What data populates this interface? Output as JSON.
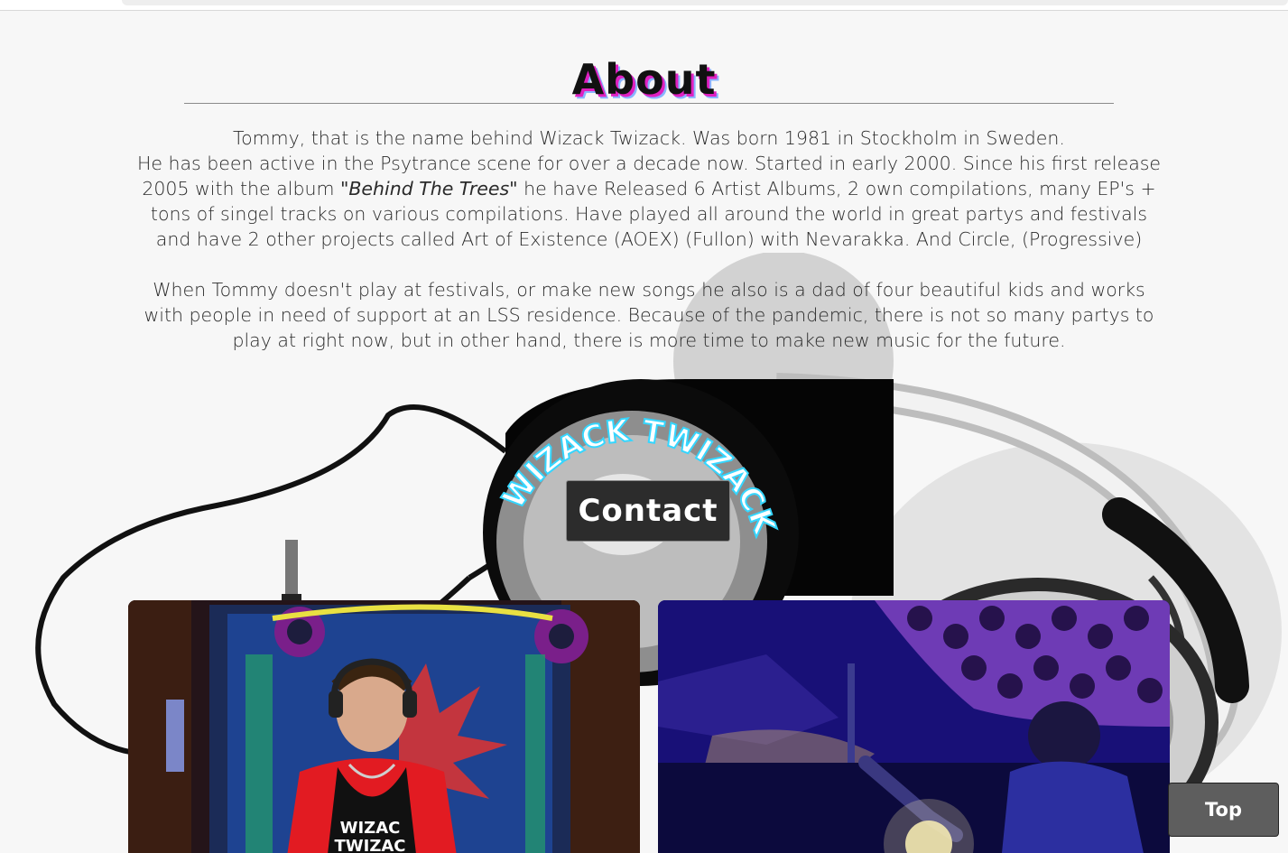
{
  "about": {
    "title": "About",
    "para1_line1": "Tommy, that is the name behind Wizack Twizack. Was born 1981 in Stockholm in Sweden.",
    "para1_line2": "He has been active in the Psytrance scene for over a decade now. Started in early 2000. Since his first release",
    "para1_line3_pre": "2005 with the album ",
    "para1_album": "\"Behind The Trees\"",
    "para1_line3_post": " he have Released 6 Artist Albums, 2 own compilations, many EP's +",
    "para1_line4": "tons of singel tracks on various compilations. Have played all around the world in great partys and festivals",
    "para1_line5": "and have 2 other projects called Art of Existence (AOEX) (Fullon) with Nevarakka. And Circle, (Progressive)",
    "para2_line1": "When Tommy doesn't play at festivals, or make new songs he also is a dad of four beautiful kids and works",
    "para2_line2": "with people in need of support at an LSS residence. Because of the pandemic, there is not so many partys to",
    "para2_line3": "play at right now, but in other hand, there is more time to make new music for the future."
  },
  "logo": {
    "text": "WIZACK TWIZACK"
  },
  "contact": {
    "label": "Contact"
  },
  "photos": {
    "left_shirt_text": "WIZAC\nTWIZAC"
  },
  "nav": {
    "top_label": "Top"
  },
  "colors": {
    "title_shadow_pink": "#e020c0",
    "title_shadow_blue": "#8ab4ff",
    "logo_glow": "#35d6ff",
    "button_bg": "#2c2c2c",
    "top_button_bg": "#5e5e5e"
  }
}
